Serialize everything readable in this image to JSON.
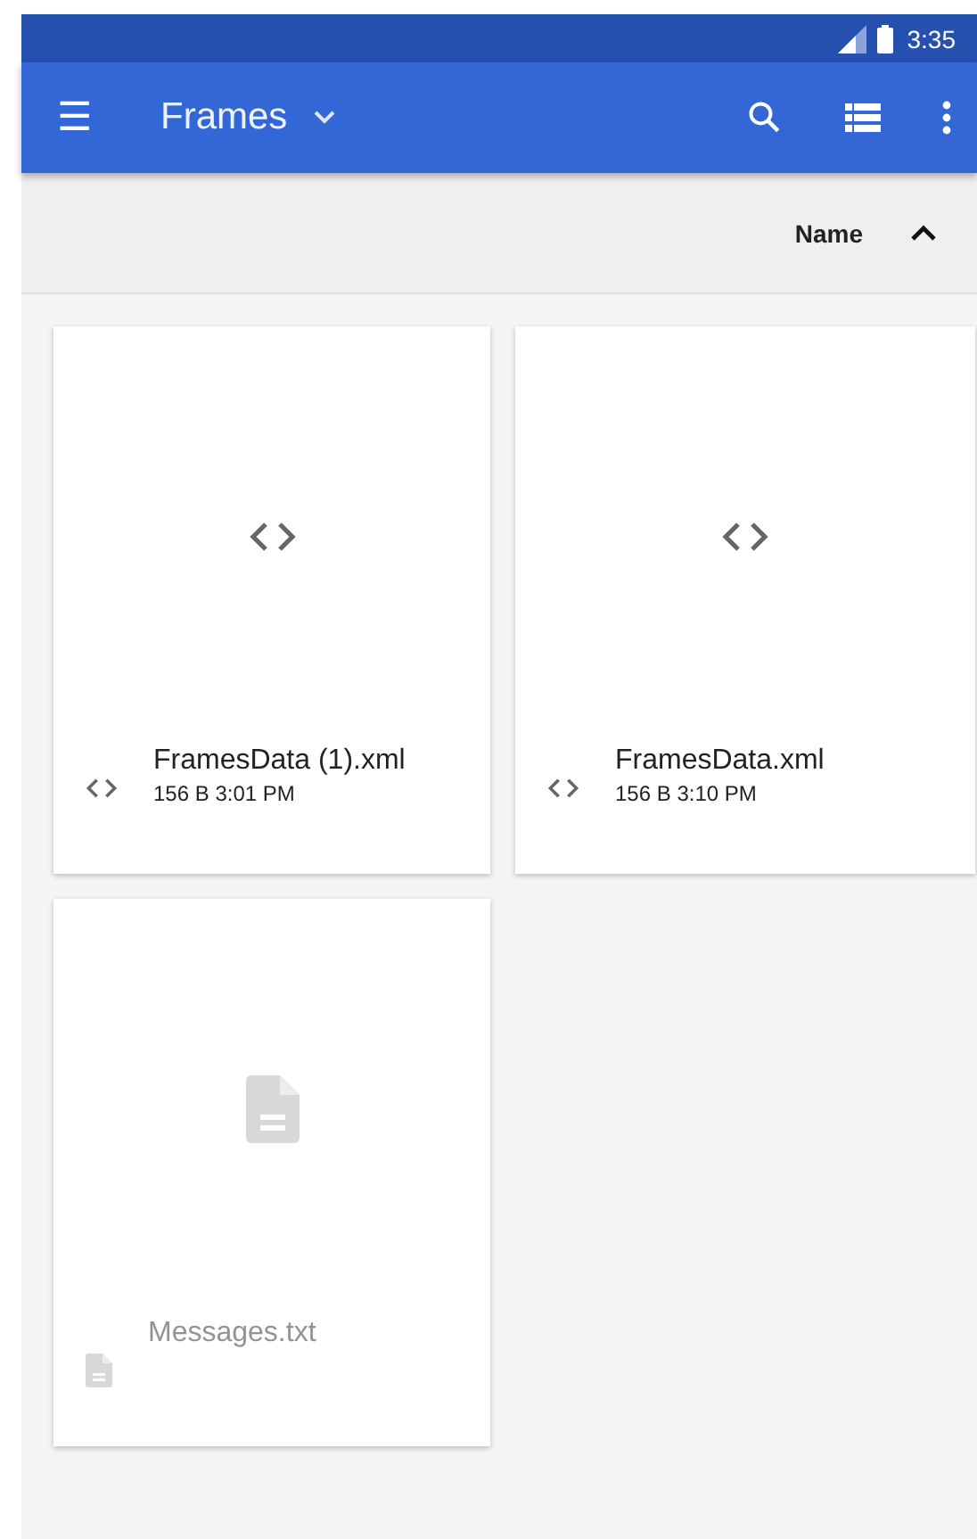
{
  "status_bar": {
    "time": "3:35"
  },
  "toolbar": {
    "menu_icon": "☰",
    "title": "Frames"
  },
  "sort_bar": {
    "label": "Name",
    "ascending": true
  },
  "files": [
    {
      "name": "FramesData (1).xml",
      "details": "156 B 3:01 PM",
      "kind": "code",
      "disabled": false
    },
    {
      "name": "FramesData.xml",
      "details": "156 B 3:10 PM",
      "kind": "code",
      "disabled": false
    },
    {
      "name": "Messages.txt",
      "kind": "document",
      "disabled": true
    }
  ]
}
